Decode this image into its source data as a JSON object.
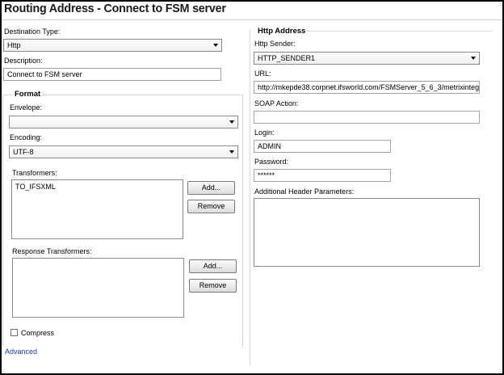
{
  "window": {
    "title": "Routing Address - Connect to FSM server"
  },
  "left": {
    "destination_type": {
      "label": "Destination Type:",
      "value": "Http"
    },
    "description": {
      "label": "Description:",
      "value": "Connect to FSM server"
    },
    "format": {
      "title": "Format",
      "envelope": {
        "label": "Envelope:",
        "value": ""
      },
      "encoding": {
        "label": "Encoding:",
        "value": "UTF-8"
      },
      "transformers": {
        "label": "Transformers:",
        "items": [
          "TO_IFSXML"
        ],
        "add_label": "Add...",
        "remove_label": "Remove"
      },
      "response_transformers": {
        "label": "Response Transformers:",
        "items": [],
        "add_label": "Add...",
        "remove_label": "Remove"
      },
      "compress": {
        "label": "Compress",
        "checked": false
      }
    },
    "advanced_link": "Advanced"
  },
  "right": {
    "title": "Http Address",
    "http_sender": {
      "label": "Http Sender:",
      "value": "HTTP_SENDER1"
    },
    "url": {
      "label": "URL:",
      "value": "http://mkepde38.corpnet.ifsworld.com/FSMServer_5_6_3/metrixinteg"
    },
    "soap_action": {
      "label": "SOAP Action:",
      "value": ""
    },
    "login": {
      "label": "Login:",
      "value": "ADMIN"
    },
    "password": {
      "label": "Password:",
      "value": "******"
    },
    "additional_headers": {
      "label": "Additional Header Parameters:",
      "value": ""
    }
  }
}
